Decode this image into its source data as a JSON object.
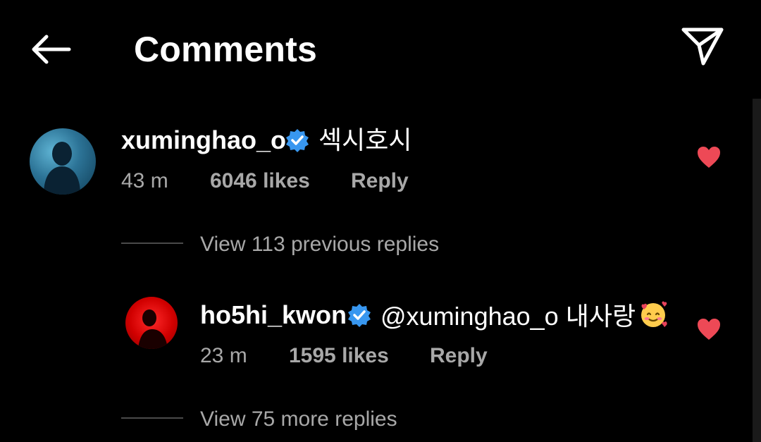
{
  "header": {
    "title": "Comments",
    "back_icon": "arrow-left-icon",
    "send_icon": "paper-plane-icon"
  },
  "colors": {
    "background": "#000000",
    "text_primary": "#ffffff",
    "text_secondary": "#a8a8a8",
    "verified_blue": "#3897f0",
    "like_red": "#ed4956"
  },
  "comments": [
    {
      "username": "xuminghao_o",
      "verified": true,
      "text": "섹시호시",
      "time": "43 m",
      "likes": "6046 likes",
      "reply_label": "Reply",
      "liked": true,
      "view_previous_replies": "View 113 previous replies",
      "replies": [
        {
          "username": "ho5hi_kwon",
          "verified": true,
          "text": "@xuminghao_o 내사랑",
          "emoji": "smiling-face-with-hearts",
          "time": "23 m",
          "likes": "1595 likes",
          "reply_label": "Reply",
          "liked": true
        }
      ],
      "view_more_replies": "View 75 more replies"
    }
  ]
}
